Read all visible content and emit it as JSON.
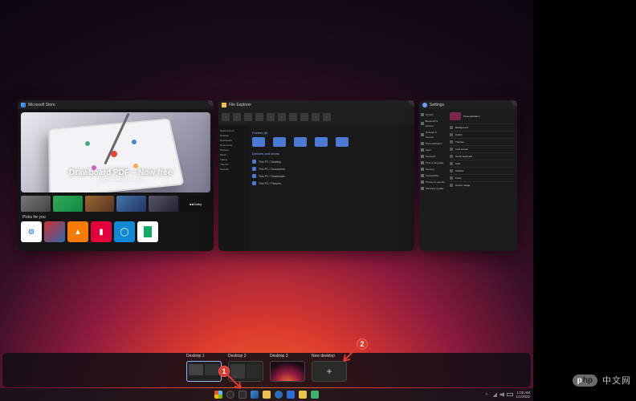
{
  "windows": {
    "store": {
      "title": "Microsoft Store",
      "hero_title": "Drawboard PDF – Now free",
      "hero_sub": "Easy PDF markup for everyone",
      "picks_label": "Picks for you"
    },
    "explorer": {
      "title": "File Explorer",
      "section_folders": "Folders (6)",
      "section_devices": "Devices and drives",
      "side_items": [
        "Quick access",
        "Desktop",
        "Downloads",
        "Documents",
        "Pictures",
        "Music",
        "Videos",
        "This PC",
        "Network"
      ],
      "rows": [
        "This PC / Desktop",
        "This PC / Documents",
        "This PC / Downloads",
        "This PC / Pictures"
      ]
    },
    "settings": {
      "title": "Settings",
      "side_items": [
        "System",
        "Bluetooth & devices",
        "Network & internet",
        "Personalization",
        "Apps",
        "Accounts",
        "Time & language",
        "Gaming",
        "Accessibility",
        "Privacy & security",
        "Windows Update"
      ],
      "main_header": "Personalization",
      "options": [
        "Background",
        "Colors",
        "Themes",
        "Lock screen",
        "Touch keyboard",
        "Start",
        "Taskbar",
        "Fonts",
        "Device usage"
      ]
    }
  },
  "desktops": {
    "items": [
      {
        "label": "Desktop 1"
      },
      {
        "label": "Desktop 2"
      },
      {
        "label": "Desktop 3"
      }
    ],
    "new_label": "New desktop",
    "plus": "+"
  },
  "taskbar": {
    "time": "1:00 AM",
    "date": "1/1/2022"
  },
  "annotations": {
    "one": "1",
    "two": "2"
  },
  "watermark": {
    "p": "p",
    "hp": "hp",
    "text": "中文网"
  }
}
